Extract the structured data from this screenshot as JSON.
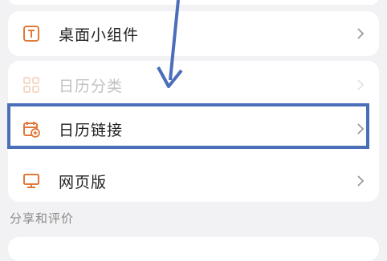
{
  "settings": {
    "items": [
      {
        "label": "桌面小组件",
        "icon": "widget-icon"
      },
      {
        "label": "日历分类",
        "icon": "category-grid-icon"
      },
      {
        "label": "日历链接",
        "icon": "calendar-link-icon"
      },
      {
        "label": "网页版",
        "icon": "monitor-icon"
      }
    ],
    "section_title": "分享和评价"
  },
  "colors": {
    "accent_orange": "#e0793a",
    "highlight_blue": "#4a6fb8",
    "background": "#f2f2f4"
  }
}
